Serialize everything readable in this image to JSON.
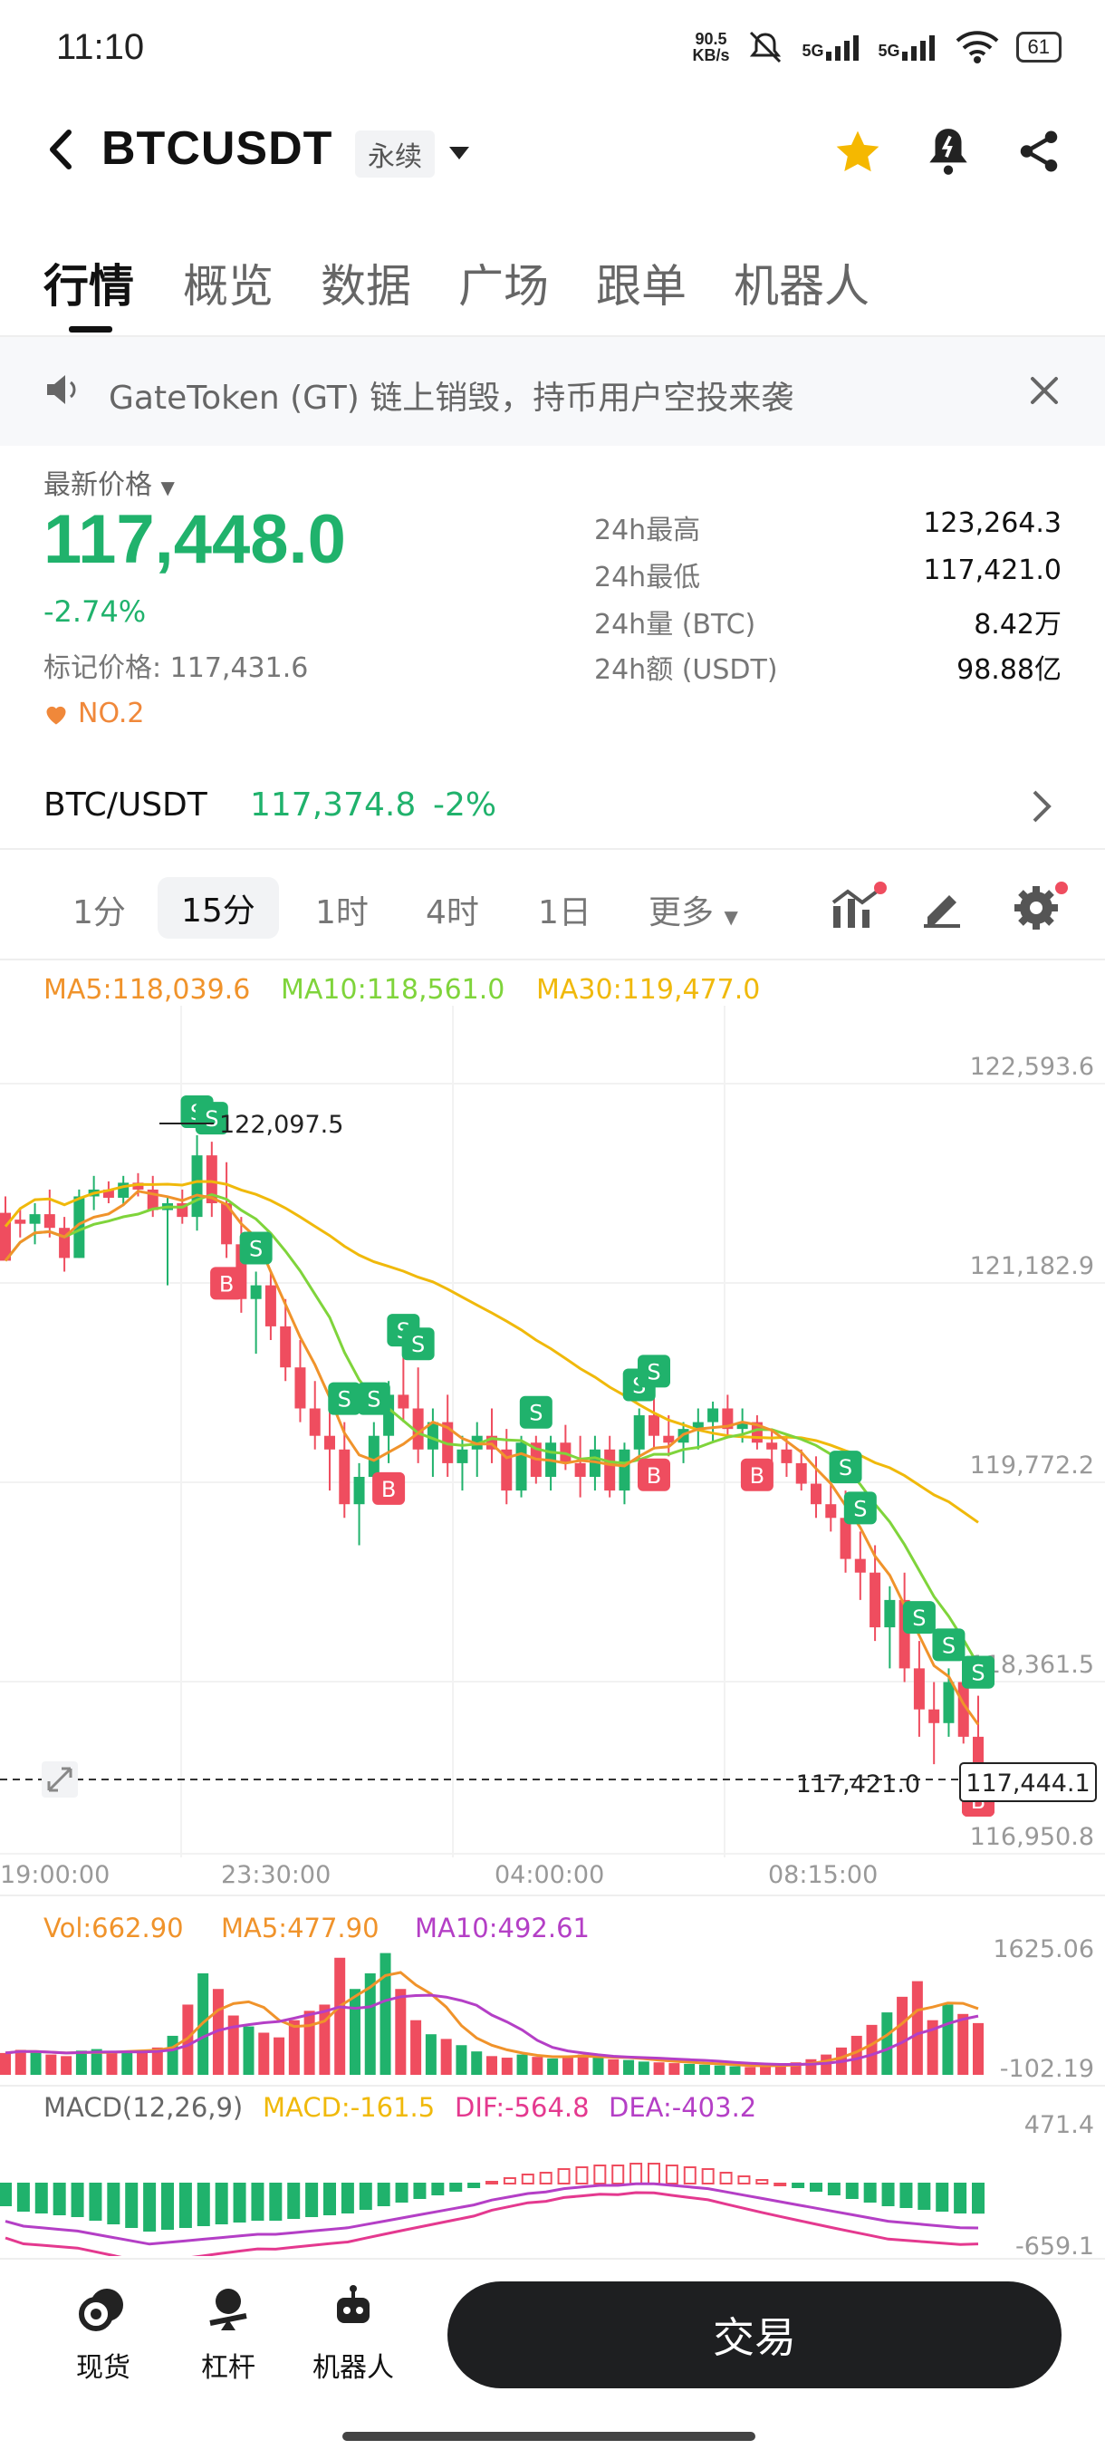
{
  "status_bar": {
    "time": "11:10",
    "net_speed_value": "90.5",
    "net_speed_unit": "KB/s",
    "signal1": "5G",
    "signal2": "5G",
    "battery": "61"
  },
  "header": {
    "title": "BTCUSDT",
    "contract_type": "永续"
  },
  "tabs": [
    "行情",
    "概览",
    "数据",
    "广场",
    "跟单",
    "机器人"
  ],
  "announcement": {
    "text": "GateToken (GT) 链上销毁，持币用户空投来袭"
  },
  "price": {
    "last_label": "最新价格",
    "last": "117,448.0",
    "change": "-2.74%",
    "mark_label": "标记价格:",
    "mark": "117,431.6",
    "rank": "NO.2",
    "stats": [
      {
        "label": "24h最高",
        "value": "123,264.3"
      },
      {
        "label": "24h最低",
        "value": "117,421.0"
      },
      {
        "label": "24h量 (BTC)",
        "value": "8.42万"
      },
      {
        "label": "24h额 (USDT)",
        "value": "98.88亿"
      }
    ]
  },
  "spot": {
    "pair": "BTC/USDT",
    "price": "117,374.8",
    "change": "-2%"
  },
  "timeframes": [
    "1分",
    "15分",
    "1时",
    "4时",
    "1日",
    "更多"
  ],
  "active_timeframe": "15分",
  "chart": {
    "ma_labels": {
      "ma5": "MA5:118,039.6",
      "ma10": "MA10:118,561.0",
      "ma30": "MA30:119,477.0"
    },
    "y_ticks": [
      "122,593.6",
      "121,182.9",
      "119,772.2",
      "118,361.5",
      "116,950.8"
    ],
    "x_ticks": [
      "19:00:00",
      "23:30:00",
      "04:00:00",
      "08:15:00"
    ],
    "high_label": "122,097.5",
    "low_label": "117,421.0",
    "current_price_label": "117,444.1",
    "vol_labels": {
      "vol": "Vol:662.90",
      "ma5": "MA5:477.90",
      "ma10": "MA10:492.61"
    },
    "vol_ticks": [
      "1625.06",
      "-102.19"
    ],
    "macd_labels": {
      "name": "MACD(12,26,9)",
      "macd": "MACD:-161.5",
      "dif": "DIF:-564.8",
      "dea": "DEA:-403.2"
    },
    "macd_ticks": [
      "471.4",
      "-659.1"
    ],
    "colors": {
      "up": "#20b26c",
      "down": "#ef4d5f",
      "ma5": "#f0932b",
      "ma10": "#7fd43b",
      "ma30": "#f0b90b",
      "vol_ma10": "#b43fc6"
    }
  },
  "chart_data": {
    "type": "candlestick",
    "y_range": [
      116950.8,
      122593.6
    ],
    "candles": [
      [
        121530,
        121650,
        121200,
        121180
      ],
      [
        121480,
        121560,
        121350,
        121450
      ],
      [
        121450,
        121600,
        121300,
        121520
      ],
      [
        121520,
        121700,
        121350,
        121420
      ],
      [
        121420,
        121500,
        121100,
        121200
      ],
      [
        121200,
        121700,
        121200,
        121650
      ],
      [
        121650,
        121800,
        121550,
        121700
      ],
      [
        121700,
        121760,
        121600,
        121640
      ],
      [
        121640,
        121800,
        121580,
        121750
      ],
      [
        121750,
        121820,
        121650,
        121700
      ],
      [
        121700,
        121800,
        121500,
        121550
      ],
      [
        121550,
        121640,
        121000,
        121600
      ],
      [
        121600,
        121700,
        121450,
        121500
      ],
      [
        121500,
        122097,
        121400,
        121950
      ],
      [
        121950,
        122050,
        121500,
        121600
      ],
      [
        121600,
        121900,
        121200,
        121300
      ],
      [
        121300,
        121500,
        120800,
        120900
      ],
      [
        120900,
        121100,
        120500,
        121000
      ],
      [
        121000,
        121100,
        120600,
        120700
      ],
      [
        120700,
        120900,
        120300,
        120400
      ],
      [
        120400,
        120600,
        120000,
        120100
      ],
      [
        120100,
        120300,
        119800,
        119900
      ],
      [
        119900,
        120100,
        119500,
        119800
      ],
      [
        119800,
        120000,
        119300,
        119400
      ],
      [
        119400,
        119700,
        119100,
        119600
      ],
      [
        119600,
        120000,
        119500,
        119900
      ],
      [
        119900,
        120300,
        119700,
        120200
      ],
      [
        120200,
        120500,
        120000,
        120100
      ],
      [
        120100,
        120400,
        119700,
        119800
      ],
      [
        119800,
        120100,
        119600,
        120000
      ],
      [
        120000,
        120200,
        119600,
        119700
      ],
      [
        119700,
        119900,
        119500,
        119800
      ],
      [
        119800,
        120000,
        119600,
        119900
      ],
      [
        119900,
        120100,
        119700,
        119800
      ],
      [
        119800,
        119950,
        119400,
        119500
      ],
      [
        119500,
        119900,
        119450,
        119850
      ],
      [
        119850,
        119900,
        119550,
        119600
      ],
      [
        119600,
        119900,
        119500,
        119850
      ],
      [
        119850,
        119980,
        119650,
        119700
      ],
      [
        119700,
        119900,
        119450,
        119600
      ],
      [
        119600,
        119900,
        119500,
        119800
      ],
      [
        119800,
        119900,
        119450,
        119500
      ],
      [
        119500,
        119850,
        119400,
        119800
      ],
      [
        119800,
        120100,
        119700,
        120050
      ],
      [
        120050,
        120200,
        119800,
        119900
      ],
      [
        119900,
        120050,
        119750,
        119850
      ],
      [
        119850,
        120000,
        119700,
        119950
      ],
      [
        119950,
        120100,
        119800,
        120000
      ],
      [
        120000,
        120150,
        119850,
        120100
      ],
      [
        120100,
        120200,
        119900,
        119950
      ],
      [
        119950,
        120100,
        119850,
        120000
      ],
      [
        120000,
        120050,
        119800,
        119850
      ],
      [
        119850,
        119950,
        119700,
        119800
      ],
      [
        119800,
        119900,
        119600,
        119700
      ],
      [
        119700,
        119800,
        119500,
        119550
      ],
      [
        119550,
        119750,
        119300,
        119400
      ],
      [
        119400,
        119600,
        119200,
        119300
      ],
      [
        119300,
        119500,
        118900,
        119000
      ],
      [
        119000,
        119200,
        118700,
        118900
      ],
      [
        118900,
        119100,
        118400,
        118500
      ],
      [
        118500,
        118800,
        118200,
        118700
      ],
      [
        118700,
        118900,
        118100,
        118200
      ],
      [
        118200,
        118400,
        117700,
        117900
      ],
      [
        117900,
        118100,
        117500,
        117800
      ],
      [
        117800,
        118200,
        117700,
        118100
      ],
      [
        118100,
        118200,
        117650,
        117700
      ],
      [
        117700,
        118000,
        117421,
        117448
      ]
    ],
    "volume": [
      280,
      320,
      300,
      260,
      240,
      310,
      330,
      300,
      310,
      290,
      350,
      500,
      900,
      1300,
      1100,
      760,
      620,
      540,
      480,
      700,
      820,
      900,
      1500,
      1100,
      1300,
      1560,
      1100,
      700,
      520,
      460,
      380,
      300,
      240,
      220,
      260,
      230,
      210,
      240,
      260,
      220,
      200,
      190,
      170,
      160,
      150,
      140,
      130,
      120,
      110,
      100,
      120,
      140,
      160,
      200,
      260,
      350,
      500,
      640,
      800,
      1000,
      1200,
      700,
      900,
      780,
      663
    ],
    "macd_hist": [
      -120,
      -150,
      -160,
      -170,
      -180,
      -200,
      -220,
      -240,
      -260,
      -250,
      -240,
      -230,
      -220,
      -210,
      -200,
      -200,
      -190,
      -180,
      -170,
      -160,
      -140,
      -120,
      -100,
      -80,
      -60,
      -40,
      -20,
      10,
      30,
      50,
      60,
      80,
      90,
      100,
      100,
      110,
      110,
      100,
      90,
      80,
      60,
      40,
      20,
      0,
      -20,
      -40,
      -60,
      -80,
      -100,
      -120,
      -130,
      -140,
      -150,
      -160,
      -161
    ]
  }
}
